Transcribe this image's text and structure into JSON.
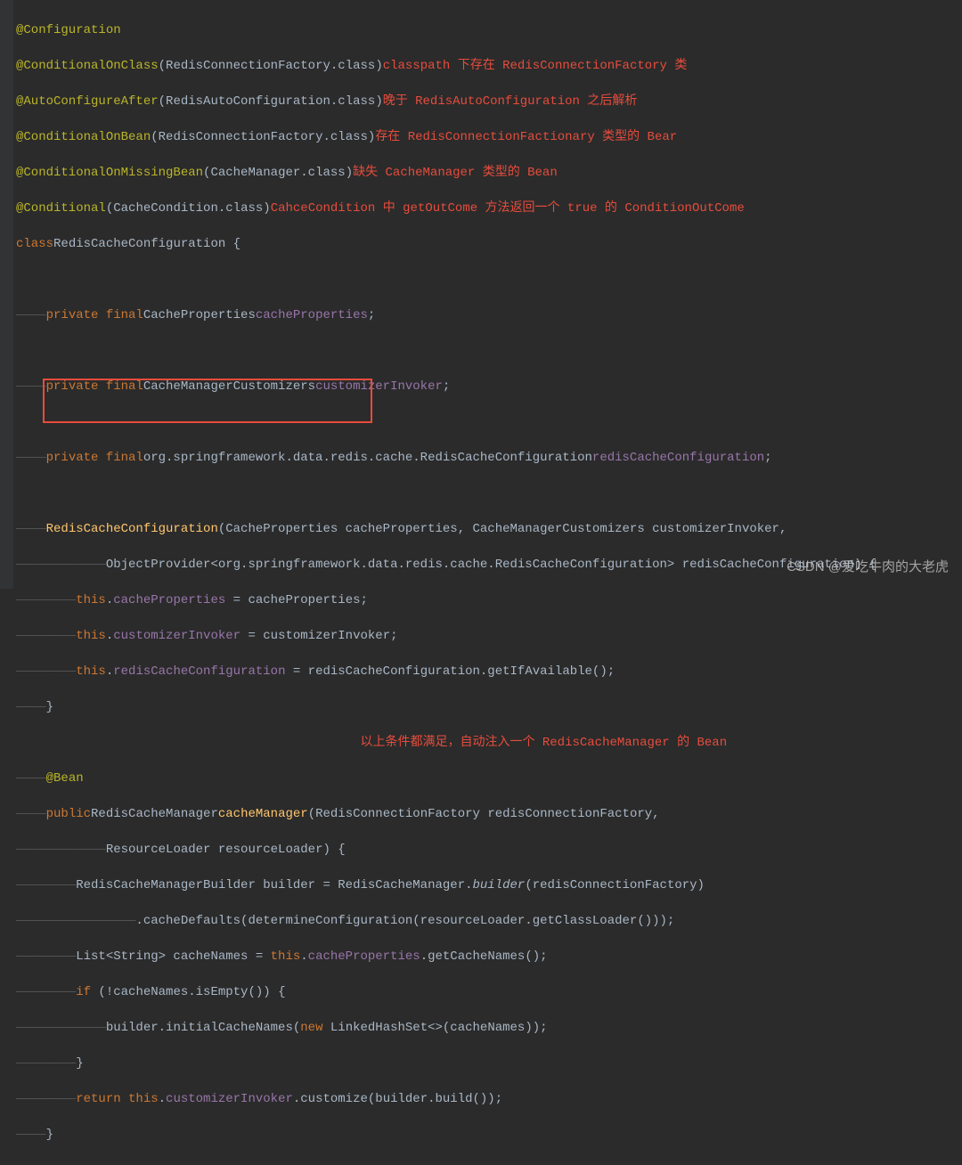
{
  "code": {
    "l1_annotation": "@Configuration",
    "l2_annotation": "@ConditionalOnClass",
    "l2_param": "RedisConnectionFactory",
    "l2_class": ".class",
    "l2_comment": "classpath 下存在 RedisConnectionFactory 类",
    "l3_annotation": "@AutoConfigureAfter",
    "l3_param": "RedisAutoConfiguration",
    "l3_class": ".class",
    "l3_comment": "晚于 RedisAutoConfiguration 之后解析",
    "l4_annotation": "@ConditionalOnBean",
    "l4_param": "RedisConnectionFactory",
    "l4_class": ".class",
    "l4_comment": "存在 RedisConnectionFactionary 类型的 Bear",
    "l5_annotation": "@ConditionalOnMissingBean",
    "l5_param": "CacheManager",
    "l5_class": ".class",
    "l5_comment": "缺失 CacheManager 类型的 Bean",
    "l6_annotation": "@Conditional",
    "l6_param": "CacheCondition",
    "l6_class": ".class",
    "l6_comment": "CahceCondition 中 getOutCome 方法返回一个 true 的 ConditionOutCome",
    "l7_kw": "class",
    "l7_name": "RedisCacheConfiguration {",
    "l9_kw": "private final",
    "l9_type": "CacheProperties",
    "l9_field": "cacheProperties",
    "l11_kw": "private final",
    "l11_type": "CacheManagerCustomizers",
    "l11_field": "customizerInvoker",
    "l13_kw": "private final",
    "l13_type": "org.springframework.data.redis.cache.RedisCacheConfiguration",
    "l13_field": "redisCacheConfiguration",
    "l15_ctor": "RedisCacheConfiguration",
    "l15_params": "(CacheProperties cacheProperties, CacheManagerCustomizers customizerInvoker,",
    "l16_params": "ObjectProvider<org.springframework.data.redis.cache.RedisCacheConfiguration> redisCacheConfiguration) {",
    "l17_this": "this",
    "l17_dot": ".",
    "l17_field": "cacheProperties",
    "l17_rest": " = cacheProperties;",
    "l18_field": "customizerInvoker",
    "l18_rest": " = customizerInvoker;",
    "l19_field": "redisCacheConfiguration",
    "l19_rest": " = redisCacheConfiguration.getIfAvailable();",
    "l20": "}",
    "l21_comment": "以上条件都满足，自动注入一个 RedisCacheManager 的 Bean",
    "l22_annotation": "@Bean",
    "l23_kw": "public",
    "l23_type": "RedisCacheManager",
    "l23_method": "cacheManager",
    "l23_params": "(RedisConnectionFactory redisConnectionFactory,",
    "l24_params": "ResourceLoader resourceLoader) {",
    "l25_type": "RedisCacheManagerBuilder builder = RedisCacheManager.",
    "l25_static": "builder",
    "l25_rest": "(redisConnectionFactory)",
    "l26_rest": ".cacheDefaults(determineConfiguration(resourceLoader.getClassLoader()));",
    "l27_a": "List<String> cacheNames = ",
    "l27_this": "this",
    "l27_dot": ".",
    "l27_field": "cacheProperties",
    "l27_rest": ".getCacheNames();",
    "l28_kw": "if",
    "l28_cond": " (!cacheNames.isEmpty()) {",
    "l29_a": "builder.initialCacheNames(",
    "l29_kw": "new",
    "l29_rest": " LinkedHashSet<>(cacheNames));",
    "l30": "}",
    "l31_kw": "return ",
    "l31_this": "this",
    "l31_dot": ".",
    "l31_field": "customizerInvoker",
    "l31_rest": ".customize(builder.build());",
    "l32": "}"
  },
  "watermark": "CSDN @爱吃牛肉的大老虎"
}
